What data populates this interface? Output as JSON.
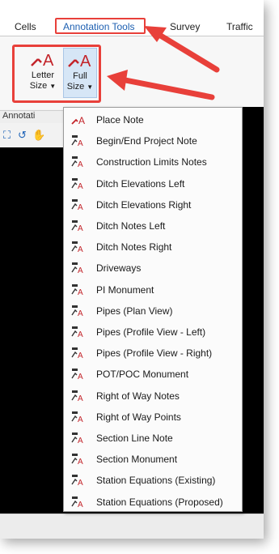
{
  "tabs": [
    {
      "label": "Cells"
    },
    {
      "label": "Annotation Tools"
    },
    {
      "label": "Survey"
    },
    {
      "label": "Traffic"
    }
  ],
  "ribbon": {
    "letter_size": {
      "line1": "Letter",
      "line2": "Size"
    },
    "full_size": {
      "line1": "Full",
      "line2": "Size"
    },
    "group_label": "Annotati"
  },
  "colors": {
    "accent": "#e8403a",
    "active_tab": "#1d5fb1",
    "icon_red": "#c3242a"
  },
  "menu": {
    "items": [
      {
        "label": "Place Note",
        "icon": "place-note-icon"
      },
      {
        "label": "Begin/End Project Note",
        "icon": "project-note-icon"
      },
      {
        "label": "Construction Limits Notes",
        "icon": "construction-limits-icon"
      },
      {
        "label": "Ditch Elevations Left",
        "icon": "ditch-elevations-left-icon"
      },
      {
        "label": "Ditch Elevations Right",
        "icon": "ditch-elevations-right-icon"
      },
      {
        "label": "Ditch Notes Left",
        "icon": "ditch-notes-left-icon"
      },
      {
        "label": "Ditch Notes Right",
        "icon": "ditch-notes-right-icon"
      },
      {
        "label": "Driveways",
        "icon": "driveways-icon"
      },
      {
        "label": "PI Monument",
        "icon": "pi-monument-icon"
      },
      {
        "label": "Pipes (Plan View)",
        "icon": "pipes-plan-icon"
      },
      {
        "label": "Pipes (Profile View - Left)",
        "icon": "pipes-profile-left-icon"
      },
      {
        "label": "Pipes (Profile View - Right)",
        "icon": "pipes-profile-right-icon"
      },
      {
        "label": "POT/POC Monument",
        "icon": "pot-poc-monument-icon"
      },
      {
        "label": "Right of Way Notes",
        "icon": "row-notes-icon"
      },
      {
        "label": "Right of Way Points",
        "icon": "row-points-icon"
      },
      {
        "label": "Section Line Note",
        "icon": "section-line-note-icon"
      },
      {
        "label": "Section Monument",
        "icon": "section-monument-icon"
      },
      {
        "label": "Station Equations (Existing)",
        "icon": "station-eq-existing-icon"
      },
      {
        "label": "Station Equations (Proposed)",
        "icon": "station-eq-proposed-icon"
      }
    ]
  }
}
